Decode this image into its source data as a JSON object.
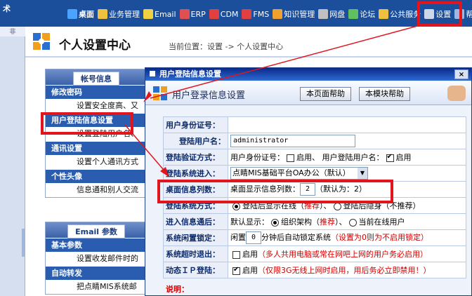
{
  "topbar": {
    "brand": "术",
    "nav_items": [
      {
        "label": "桌面",
        "icon": "desktop-icon",
        "color": "#4aa3ff",
        "bold": true
      },
      {
        "label": "业务管理",
        "icon": "person-icon",
        "color": "#f0c040"
      },
      {
        "label": "Email",
        "icon": "mail-icon",
        "color": "#f0d040"
      },
      {
        "label": "ERP",
        "icon": "erp-icon",
        "color": "#e05050"
      },
      {
        "label": "CDM",
        "icon": "cdm-icon",
        "color": "#e04040"
      },
      {
        "label": "FMS",
        "icon": "fms-icon",
        "color": "#e04040"
      },
      {
        "label": "知识管理",
        "icon": "knowledge-icon",
        "color": "#f0a030"
      },
      {
        "label": "网盘",
        "icon": "disk-icon",
        "color": "#c0c0c0"
      },
      {
        "label": "论坛",
        "icon": "forum-icon",
        "color": "#60c060"
      },
      {
        "label": "公共服务",
        "icon": "service-icon",
        "color": "#f0c040"
      },
      {
        "label": "设置",
        "icon": "settings-icon",
        "color": "#cfd8e8"
      },
      {
        "label": "帮",
        "icon": "help-icon",
        "color": "#9fb7df"
      }
    ]
  },
  "strip_label": "非",
  "page": {
    "title": "个人设置中心",
    "location": "当前位置：设置 -> 个人设置中心"
  },
  "panels": [
    {
      "title": "帐号信息",
      "sections": [
        {
          "category": "修改密码",
          "sub": "设置安全度高、又"
        },
        {
          "category": "用户登陆信息设置",
          "sub": "设置登陆用户名、"
        },
        {
          "category": "通讯设置",
          "sub": "设置个人通讯方式"
        },
        {
          "category": "个性头像",
          "sub": "信息通和别人交流"
        }
      ]
    },
    {
      "title": "Email 参数",
      "sections": [
        {
          "category": "基本参数",
          "sub": "设置收发邮件时的"
        },
        {
          "category": "自动转发",
          "sub": "把点睛MIS系统邮"
        }
      ]
    }
  ],
  "dialog": {
    "title": "用户登陆信息设置",
    "close": "×",
    "heading": "用户登录信息设置",
    "help_page": "本页面帮助",
    "help_module": "本模块帮助",
    "rows": {
      "id_label": "用户身份证号：",
      "user_label": "登陆用户名：",
      "user_value": "administrator",
      "verify_label": "登陆验证方式：",
      "verify_id": "用户身份证号：",
      "verify_id_state": "启用、",
      "verify_user": "用户登陆用户名：",
      "verify_user_state": "启用",
      "system_label": "登陆系统进入：",
      "system_value": "点睛MIS基础平台OA办公（默认）",
      "count_label": "桌面信息列数：",
      "count_text": "桌面显示信息列数：",
      "count_value": "2",
      "count_default": "（默认为：2）",
      "mode_label": "登陆系统方式：",
      "mode_online": "登陆后显示在线（",
      "mode_recommend": "推荐",
      "mode_online_end": "）、",
      "mode_hidden": "登陆后隐身（不推荐）",
      "after_label": "进入信息通后：",
      "after_text": "默认显示：",
      "after_org": "组织架构（",
      "after_recommend": "推荐",
      "after_org_end": "）、",
      "after_online": "当前在线用户",
      "idle_label": "系统闲置锁定：",
      "idle_prefix": "闲置",
      "idle_value": "0",
      "idle_suffix": "分钟后自动锁定系统",
      "idle_note": "（设置为0则为不启用锁定）",
      "timeout_label": "系统超时退出：",
      "timeout_state": "启用",
      "timeout_note": "（多人共用电脑或常在网吧上网的用户务必启用）",
      "ip_label": "动态ＩＰ登陆：",
      "ip_state": "启用",
      "ip_note": "（仅限3G无线上网时启用，用后务必立即禁用！）"
    },
    "note": "说明："
  },
  "colors": {
    "topbar": "#1b4f9c",
    "accent_red": "#e2141c",
    "category": "#2a5db0"
  }
}
